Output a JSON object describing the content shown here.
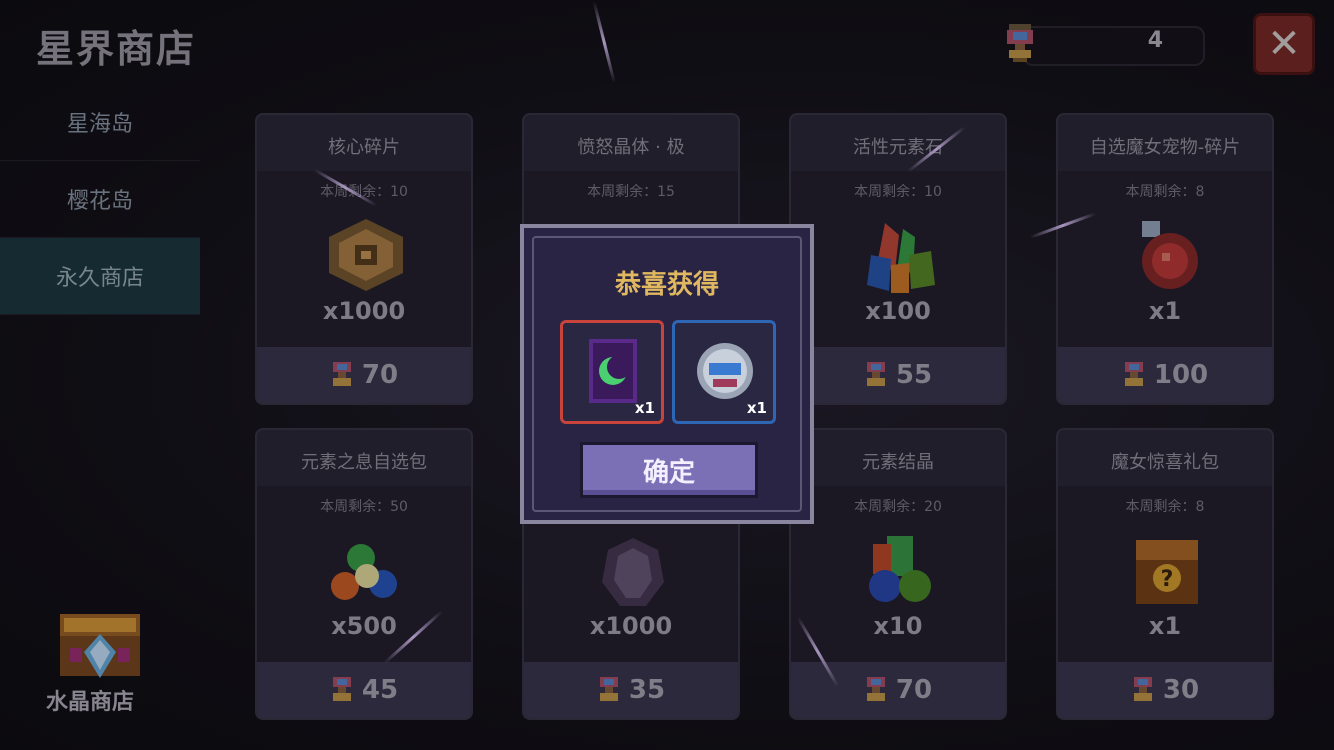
{
  "header": {
    "title": "星界商店",
    "currency_value": "4",
    "close_label": "✕"
  },
  "sidebar": {
    "items": [
      {
        "label": "星海岛"
      },
      {
        "label": "樱花岛"
      },
      {
        "label": "永久商店",
        "active": true
      }
    ]
  },
  "crystal_shop": {
    "label": "水晶商店"
  },
  "cards": [
    {
      "name": "核心碎片",
      "stock": "本周剩余：10",
      "qty": "x1000",
      "price": "70"
    },
    {
      "name": "愤怒晶体 · 极",
      "stock": "本周剩余：15",
      "qty": "",
      "price": ""
    },
    {
      "name": "活性元素石",
      "stock": "本周剩余：10",
      "qty": "x100",
      "price": "55"
    },
    {
      "name": "自选魔女宠物-碎片",
      "stock": "本周剩余：8",
      "qty": "x1",
      "price": "100"
    },
    {
      "name": "元素之息自选包",
      "stock": "本周剩余：50",
      "qty": "x500",
      "price": "45"
    },
    {
      "name": "",
      "stock": "",
      "qty": "x1000",
      "price": "35"
    },
    {
      "name": "元素结晶",
      "stock": "本周剩余：20",
      "qty": "x10",
      "price": "70"
    },
    {
      "name": "魔女惊喜礼包",
      "stock": "本周剩余：8",
      "qty": "x1",
      "price": "30"
    }
  ],
  "dialog": {
    "title": "恭喜获得",
    "rewards": [
      {
        "count": "x1",
        "icon": "green-crescent-card-icon"
      },
      {
        "count": "x1",
        "icon": "robot-helmet-icon"
      }
    ],
    "confirm_label": "确定"
  }
}
